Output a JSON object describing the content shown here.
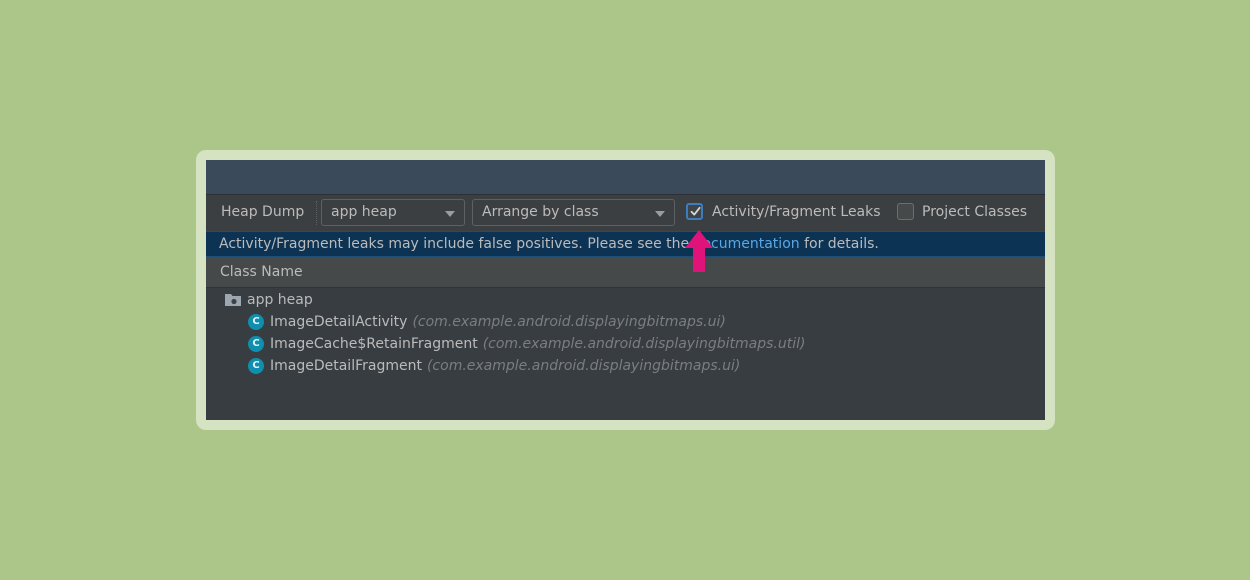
{
  "toolbar": {
    "title": "Heap Dump",
    "heap_select": {
      "value": "app heap"
    },
    "arrange_select": {
      "value": "Arrange by class"
    },
    "leaks_checkbox": {
      "label": "Activity/Fragment Leaks",
      "checked": true
    },
    "project_checkbox": {
      "label": "Project Classes",
      "checked": false
    }
  },
  "banner": {
    "text_before": "Activity/Fragment leaks may include false positives. Please see the ",
    "link_text": "documentation",
    "text_after": " for details."
  },
  "table": {
    "column_header": "Class Name",
    "root": {
      "label": "app heap",
      "icon": "folder-icon"
    },
    "rows": [
      {
        "name": "ImageDetailActivity",
        "package": "(com.example.android.displayingbitmaps.ui)",
        "icon_letter": "C"
      },
      {
        "name": "ImageCache$RetainFragment",
        "package": "(com.example.android.displayingbitmaps.util)",
        "icon_letter": "C"
      },
      {
        "name": "ImageDetailFragment",
        "package": "(com.example.android.displayingbitmaps.ui)",
        "icon_letter": "C"
      }
    ]
  },
  "colors": {
    "background": "#acc68a",
    "highlight_arrow": "#e0137a",
    "link": "#5aa7e6",
    "class_icon": "#0f8fad"
  }
}
